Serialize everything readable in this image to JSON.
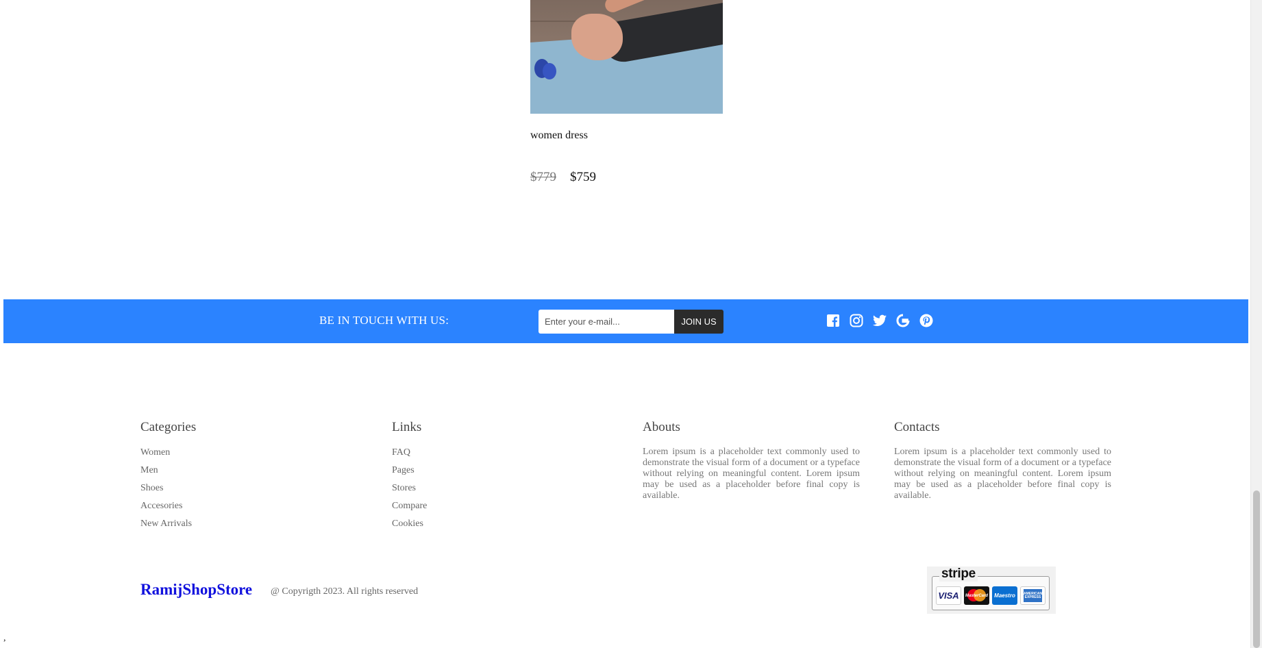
{
  "product": {
    "title": "women dress",
    "old_price": "$779",
    "price": "$759"
  },
  "newsletter": {
    "title": "BE IN TOUCH WITH US:",
    "email_placeholder": "Enter your e-mail...",
    "button_label": "JOIN US",
    "background_color": "#2b83ff",
    "social_icons": [
      "facebook-icon",
      "instagram-icon",
      "twitter-icon",
      "google-icon",
      "pinterest-icon"
    ]
  },
  "footer": {
    "categories": {
      "title": "Categories",
      "items": [
        "Women",
        "Men",
        "Shoes",
        "Accesories",
        "New Arrivals"
      ]
    },
    "links": {
      "title": "Links",
      "items": [
        "FAQ",
        "Pages",
        "Stores",
        "Compare",
        "Cookies"
      ]
    },
    "abouts": {
      "title": "Abouts",
      "text": "Lorem ipsum is a placeholder text commonly used to demonstrate the visual form of a document or a typeface without relying on meaningful content. Lorem ipsum may be used as a placeholder before final copy is available."
    },
    "contacts": {
      "title": "Contacts",
      "text": "Lorem ipsum is a placeholder text commonly used to demonstrate the visual form of a document or a typeface without relying on meaningful content. Lorem ipsum may be used as a placeholder before final copy is available."
    },
    "brand": "RamijShopStore",
    "copyright": "@ Copyrigth 2023. All rights reserved",
    "payment": {
      "provider": "stripe",
      "cards": [
        "VISA",
        "MasterCard",
        "Maestro",
        "American Express"
      ]
    }
  },
  "stray_text": ","
}
